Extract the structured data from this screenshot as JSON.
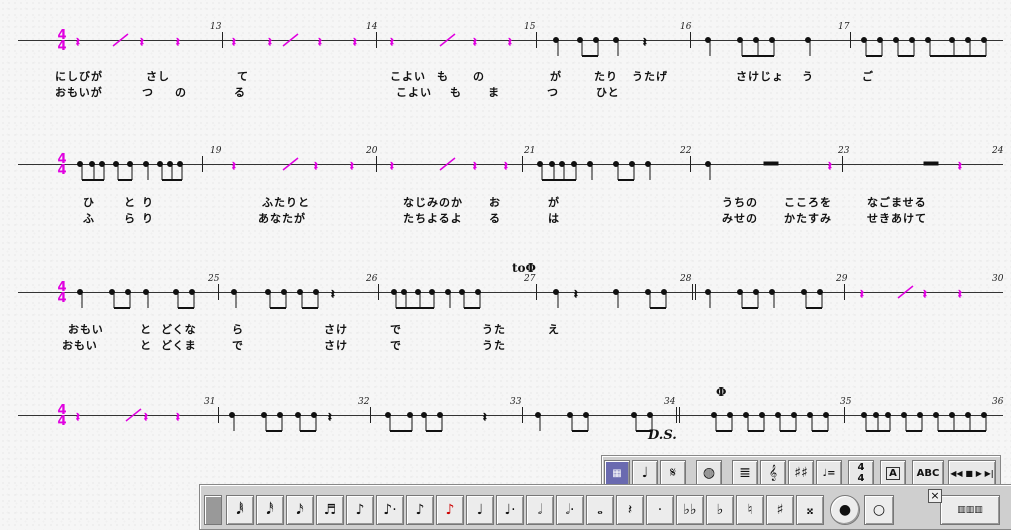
{
  "time_signature": {
    "top": "4",
    "bottom": "4"
  },
  "systems": [
    {
      "measure_numbers": [
        "13",
        "14",
        "15",
        "16",
        "17"
      ],
      "lyrics_line1": [
        "にしびが",
        "さし",
        "て",
        "こよい",
        "も",
        "の",
        "が",
        "たり",
        "うたげ",
        "さけじょ",
        "う",
        "ご"
      ],
      "lyrics_line2": [
        "おもいが",
        "つ",
        "の",
        "る",
        "こよい",
        "も",
        "ま",
        "つ",
        "ひと"
      ]
    },
    {
      "measure_numbers": [
        "19",
        "20",
        "21",
        "22",
        "23",
        "24"
      ],
      "lyrics_line1": [
        "ひ",
        "と",
        "り",
        "ふたりと",
        "なじみのか",
        "お",
        "が",
        "うちの",
        "こころを",
        "なごませる"
      ],
      "lyrics_line2": [
        "ふ",
        "ら",
        "り",
        "あなたが",
        "たちよるよ",
        "る",
        "は",
        "みせの",
        "かたすみ",
        "せきあけて"
      ]
    },
    {
      "measure_numbers": [
        "25",
        "26",
        "27",
        "28",
        "29",
        "30"
      ],
      "to_coda": "to",
      "lyrics_line1": [
        "おもい",
        "と",
        "どくな",
        "ら",
        "さけ",
        "で",
        "うた",
        "え"
      ],
      "lyrics_line2": [
        "おもい",
        "と",
        "どくま",
        "で",
        "さけ",
        "で",
        "うた"
      ]
    },
    {
      "measure_numbers": [
        "31",
        "32",
        "33",
        "34",
        "35",
        "36"
      ],
      "ds_label": "D.S.",
      "lyrics_line1": [],
      "lyrics_line2": []
    }
  ],
  "toolbar_top": {
    "abc_label": "ABC",
    "text_label": "A",
    "tempo_label": "♩=",
    "transport_label": "◀◀ ■ ▶ ▶|"
  },
  "toolbar_bottom": {
    "close_label": "×"
  },
  "colors": {
    "accent": "#e000e0",
    "staff": "#333333"
  }
}
